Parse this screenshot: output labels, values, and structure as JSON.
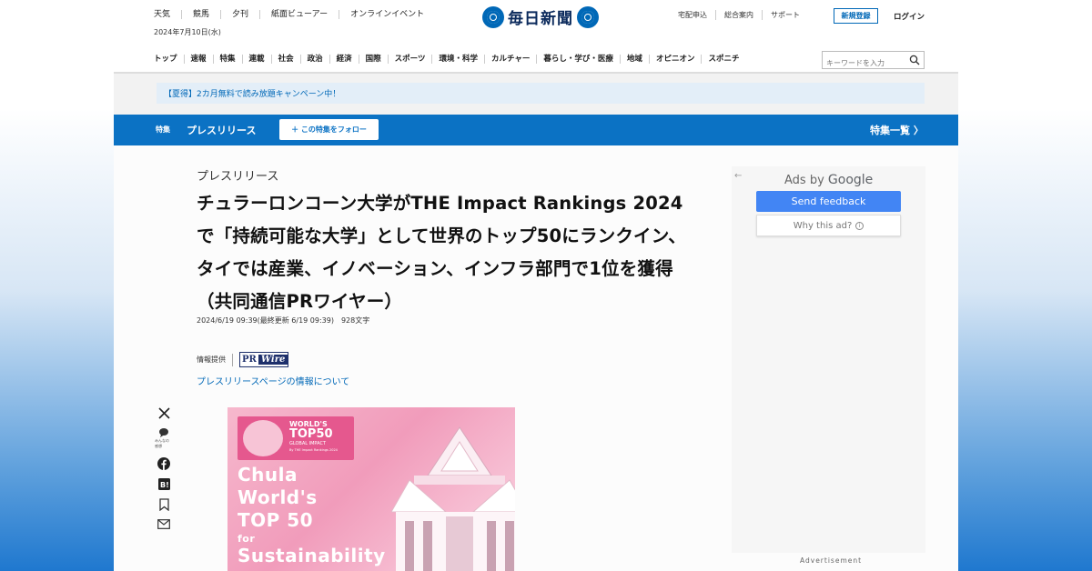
{
  "header": {
    "top_links": [
      "天気",
      "競馬",
      "夕刊",
      "紙面ビューアー",
      "オンラインイベント"
    ],
    "date": "2024年7月10日(水)",
    "logo_text": "毎日新聞",
    "util_links": [
      "宅配申込",
      "総合案内",
      "サポート"
    ],
    "register_label": "新規登録",
    "login_label": "ログイン"
  },
  "nav": {
    "categories": [
      "トップ",
      "速報",
      "特集",
      "連載",
      "社会",
      "政治",
      "経済",
      "国際",
      "スポーツ",
      "環境・科学",
      "カルチャー",
      "暮らし・学び・医療",
      "地域",
      "オピニオン",
      "スポニチ"
    ],
    "search_placeholder": "キーワードを入力"
  },
  "promo": {
    "text": "【夏得】2カ月無料で読み放題キャンペーン中！"
  },
  "feature_bar": {
    "tag": "特集",
    "title": "プレスリリース",
    "follow_label": "＋ この特集をフォロー",
    "list_label": "特集一覧 〉"
  },
  "article": {
    "kicker": "プレスリリース",
    "headline": "チュラーロンコーン大学がTHE Impact Rankings 2024で「持続可能な大学」として世界のトップ50にランクイン、タイでは産業、イノベーション、インフラ部門で1位を獲得（共同通信PRワイヤー）",
    "meta": "2024/6/19 09:39(最終更新 6/19 09:39)　928文字",
    "provider_label": "情報提供",
    "provider_logo_pr": "PR",
    "provider_logo_wire": "Wire",
    "pr_link": "プレスリリースページの情報について"
  },
  "share": {
    "icons": [
      "x-icon",
      "comment-icon",
      "facebook-icon",
      "hatena-icon",
      "bookmark-icon",
      "mail-icon"
    ],
    "comment_label": "みんなの\n感想"
  },
  "hero_image": {
    "badge_line1": "WORLD'S",
    "badge_line2": "TOP50",
    "badge_line3": "GLOBAL IMPACT",
    "badge_line4": "By THE Impact Rankings 2024",
    "lines": [
      "Chula",
      "World's",
      "TOP 50",
      "for",
      "Sustainability"
    ]
  },
  "ad": {
    "ads_by": "Ads by",
    "google": "Google",
    "send_feedback": "Send feedback",
    "why_this_ad": "Why this ad?",
    "advertisement_label": "Advertisement"
  }
}
